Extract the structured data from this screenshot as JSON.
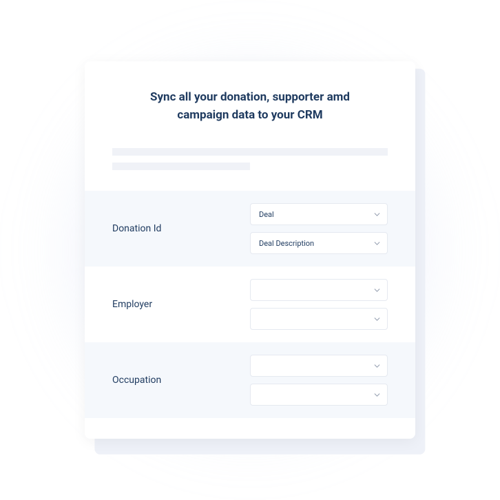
{
  "card": {
    "title": "Sync all your donation, supporter amd campaign data to your CRM"
  },
  "mappings": [
    {
      "label": "Donation Id",
      "select1": "Deal",
      "select2": "Deal Description"
    },
    {
      "label": "Employer",
      "select1": "",
      "select2": ""
    },
    {
      "label": "Occupation",
      "select1": "",
      "select2": ""
    }
  ]
}
